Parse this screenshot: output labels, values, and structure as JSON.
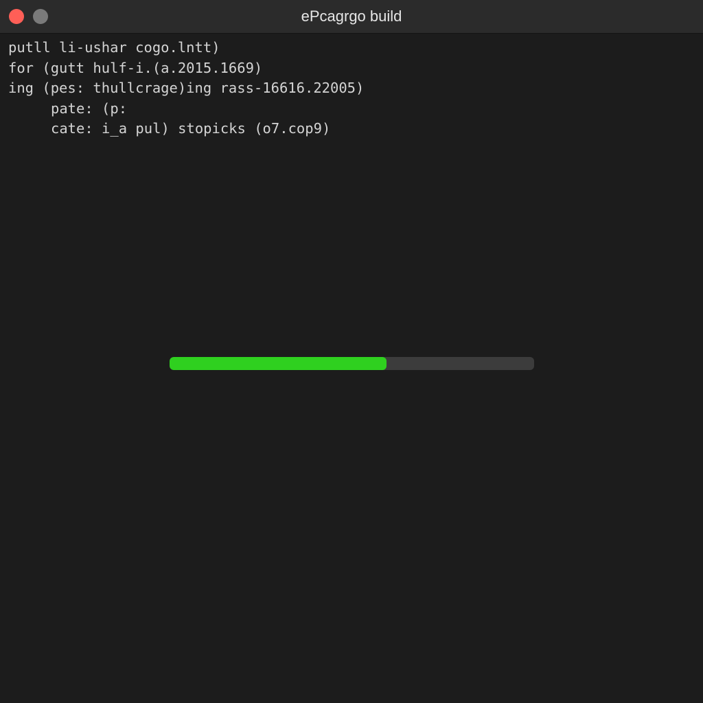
{
  "window": {
    "title": "ePcagrgo build"
  },
  "terminal": {
    "lines": [
      "putll li-ushar cogo.lntt)",
      "for (gutt hulf-i.(a.2015.1669)",
      "ing (pes: thullcrage)ing rass-16616.22005)",
      "pate: (p:",
      "cate: i_a pul) stopicks (o7.cop9)"
    ]
  },
  "progress": {
    "fraction": 0.595,
    "fill_color": "#2fd01f",
    "track_color": "#3c3c3c"
  },
  "colors": {
    "background": "#1c1c1c",
    "titlebar": "#2b2b2b",
    "close_button": "#ff5f57",
    "minimize_button": "#7a7a7a",
    "text": "#d4d4d4"
  }
}
